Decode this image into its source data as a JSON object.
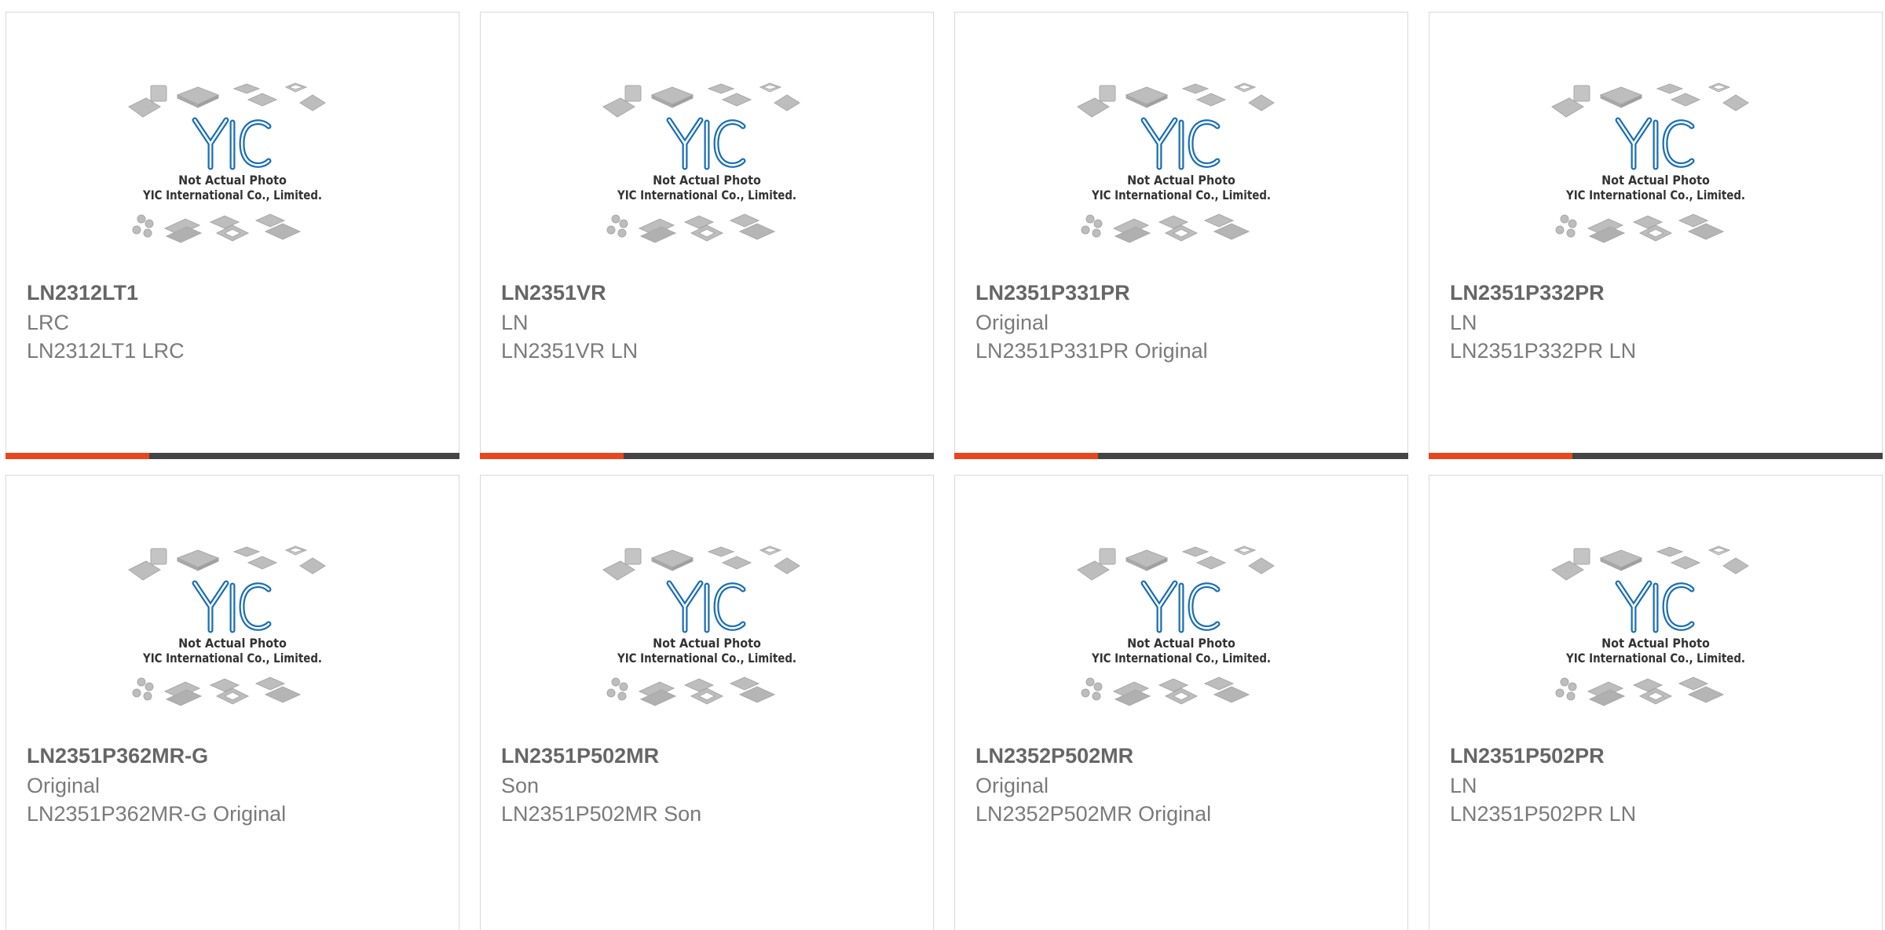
{
  "colors": {
    "accent": "#e8461e",
    "bar": "#444444",
    "logo_blue": "#1a6fb5",
    "logo_light": "#5ab4e5",
    "chip_gray": "#bdbdbd"
  },
  "placeholder": {
    "line1": "Not Actual Photo",
    "line2": "YIC International Co., Limited.",
    "logo_icon": "yic-logo-icon"
  },
  "products": [
    {
      "part": "LN2312LT1",
      "brand": "LRC",
      "desc": "LN2312LT1 LRC"
    },
    {
      "part": "LN2351VR",
      "brand": "LN",
      "desc": "LN2351VR LN"
    },
    {
      "part": "LN2351P331PR",
      "brand": "Original",
      "desc": "LN2351P331PR Original"
    },
    {
      "part": "LN2351P332PR",
      "brand": "LN",
      "desc": "LN2351P332PR LN"
    },
    {
      "part": "LN2351P362MR-G",
      "brand": "Original",
      "desc": "LN2351P362MR-G Original"
    },
    {
      "part": "LN2351P502MR",
      "brand": "Son",
      "desc": "LN2351P502MR Son"
    },
    {
      "part": "LN2352P502MR",
      "brand": "Original",
      "desc": "LN2352P502MR Original"
    },
    {
      "part": "LN2351P502PR",
      "brand": "LN",
      "desc": "LN2351P502PR LN"
    }
  ]
}
